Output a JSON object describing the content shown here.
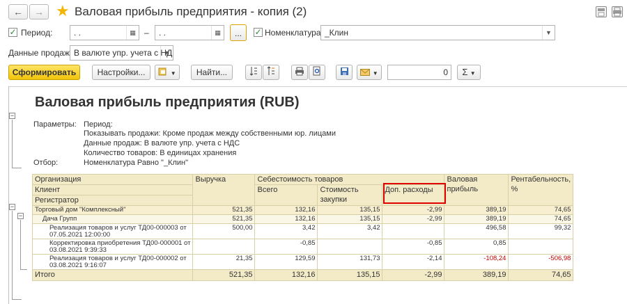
{
  "window": {
    "title": "Валовая прибыль предприятия - копия (2)"
  },
  "filters": {
    "period_label": "Период:",
    "date_from": " .  .",
    "date_separator": "–",
    "date_to": " .  .",
    "ellipsis": "...",
    "nomenclature_label": "Номенклатура:",
    "nomenclature_value": "_Клин",
    "sales_data_label": "Данные продаж:",
    "sales_data_value": "В валюте упр. учета с НД"
  },
  "toolbar": {
    "generate": "Сформировать",
    "settings": "Настройки...",
    "find": "Найти...",
    "sum_value": "0",
    "sigma": "Σ"
  },
  "report": {
    "title": "Валовая прибыль предприятия (RUB)",
    "params_label": "Параметры:",
    "params": [
      "Период:",
      "Показывать продажи: Кроме продаж между собственными юр. лицами",
      "Данные продаж: В валюте упр. учета с НДС",
      "Количество товаров: В единицах хранения"
    ],
    "filter_label": "Отбор:",
    "filter_value": "Номенклатура Равно \"_Клин\""
  },
  "table": {
    "headers": {
      "org": "Организация",
      "client": "Клиент",
      "registrar": "Регистратор",
      "revenue": "Выручка",
      "cost": "Себестоимость товаров",
      "total": "Всего",
      "purchase_cost_1": "Стоимость",
      "purchase_cost_2": "закупки",
      "extra": "Доп. расходы",
      "gross_1": "Валовая",
      "gross_2": "прибыль",
      "profit_1": "Рентабельность,",
      "profit_2": "%"
    },
    "rows": [
      {
        "name": "Торговый дом \"Комплексный\"",
        "revenue": "521,35",
        "total": "132,16",
        "purchase": "135,15",
        "extra": "-2,99",
        "gross": "389,19",
        "profit": "74,65"
      },
      {
        "name": "Дача Групп",
        "revenue": "521,35",
        "total": "132,16",
        "purchase": "135,15",
        "extra": "-2,99",
        "gross": "389,19",
        "profit": "74,65"
      },
      {
        "name1": "Реализация товаров и услуг ТД00-000003 от",
        "name2": "07.05.2021 12:00:00",
        "revenue": "500,00",
        "total": "3,42",
        "purchase": "3,42",
        "extra": "",
        "gross": "496,58",
        "profit": "99,32"
      },
      {
        "name1": "Корректировка приобретения ТД00-000001 от",
        "name2": "03.08.2021 9:39:33",
        "revenue": "",
        "total": "-0,85",
        "purchase": "",
        "extra": "-0,85",
        "gross": "0,85",
        "profit": ""
      },
      {
        "name1": "Реализация товаров и услуг ТД00-000002 от",
        "name2": "03.08.2021 9:16:07",
        "revenue": "21,35",
        "total": "129,59",
        "purchase": "131,73",
        "extra": "-2,14",
        "gross": "-108,24",
        "profit": "-506,98"
      }
    ],
    "total_row": {
      "name": "Итого",
      "revenue": "521,35",
      "total": "132,16",
      "purchase": "135,15",
      "extra": "-2,99",
      "gross": "389,19",
      "profit": "74,65"
    }
  },
  "colors": {
    "accent": "#f2c30a",
    "header_bg": "#f3ebc8",
    "negative": "#c00000",
    "highlight": "#e00000"
  },
  "icons": [
    "back-arrow-icon",
    "forward-arrow-icon",
    "favorite-star-icon",
    "save-icon",
    "print-icon",
    "checkbox-checked-icon",
    "calendar-icon",
    "dropdown-icon",
    "variants-icon",
    "sort-icon",
    "group-icon",
    "print-preview-icon",
    "mail-icon",
    "sigma-icon"
  ]
}
